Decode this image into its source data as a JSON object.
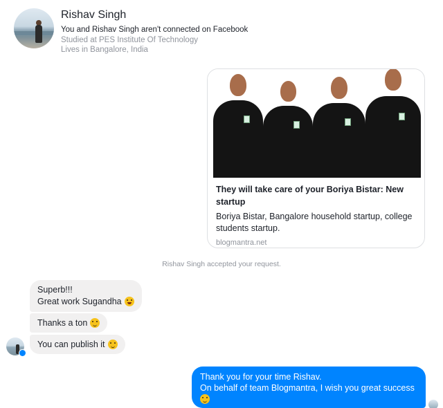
{
  "header": {
    "name": "Rishav Singh",
    "connection": "You and Rishav Singh aren't connected on Facebook",
    "studied": "Studied at PES Institute Of Technology",
    "lives": "Lives in Bangalore, India"
  },
  "link_card": {
    "title": "They will take care of your Boriya Bistar: New startup",
    "description": "Boriya Bistar, Bangalore household startup, college students startup.",
    "domain": "blogmantra.net"
  },
  "status": "Rishav Singh accepted your request.",
  "received": [
    {
      "line1": "Superb!!!",
      "line2": "Great work Sugandha",
      "emoji": "grinning-emoji-icon"
    },
    {
      "text": "Thanks a ton",
      "emoji": "smile-emoji-icon"
    },
    {
      "text": "You can publish it",
      "emoji": "smile-emoji-icon"
    }
  ],
  "sent": {
    "line1": "Thank you for your time Rishav.",
    "line2": "On behalf of team Blogmantra, I wish you great success",
    "emoji": "smile-emoji-icon"
  }
}
